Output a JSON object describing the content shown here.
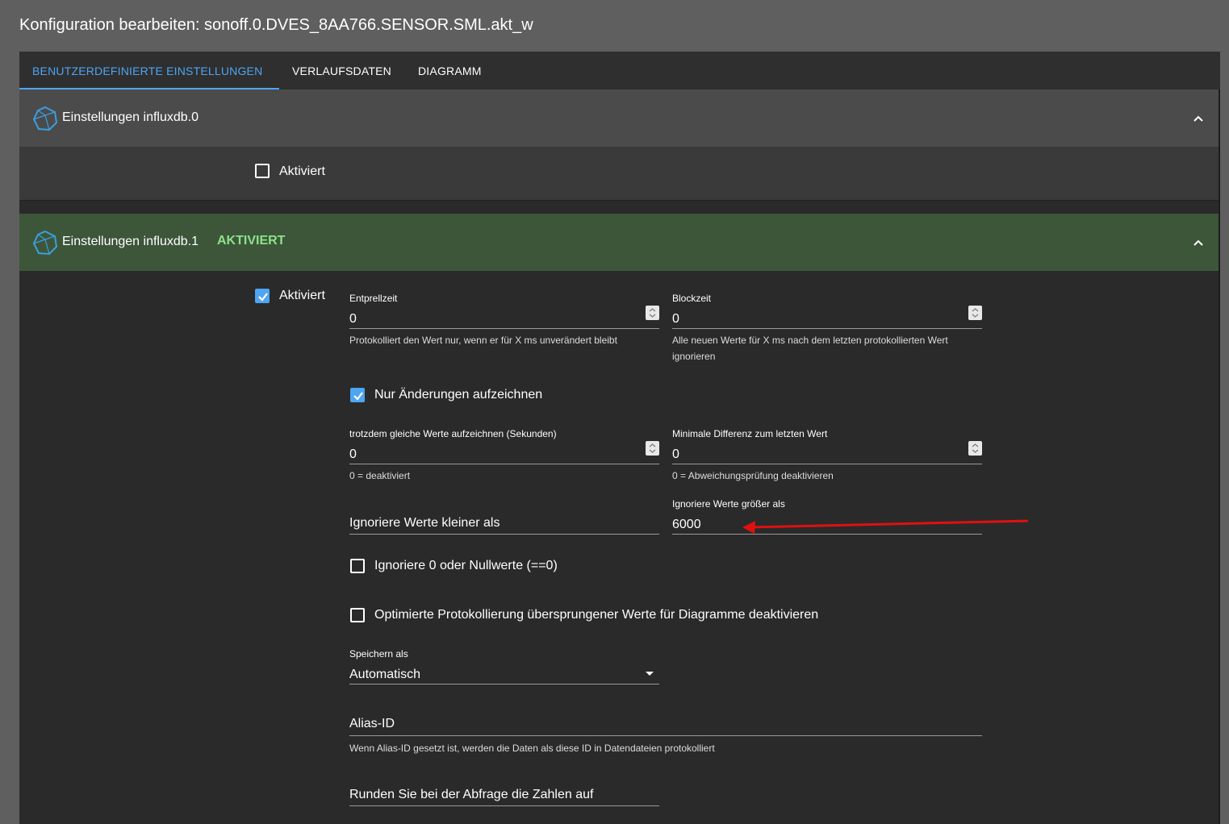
{
  "dialog": {
    "title": "Konfiguration bearbeiten: sonoff.0.DVES_8AA766.SENSOR.SML.akt_w"
  },
  "tabs": [
    {
      "label": "BENUTZERDEFINIERTE EINSTELLUNGEN",
      "active": true
    },
    {
      "label": "VERLAUFSDATEN",
      "active": false
    },
    {
      "label": "DIAGRAMM",
      "active": false
    }
  ],
  "sections": [
    {
      "title": "Einstellungen influxdb.0",
      "badge": "",
      "enabled_label": "Aktiviert",
      "enabled": false
    },
    {
      "title": "Einstellungen influxdb.1",
      "badge": "AKTIVIERT",
      "enabled_label": "Aktiviert",
      "enabled": true,
      "fields": {
        "debounce": {
          "label": "Entprellzeit",
          "value": "0",
          "helper": "Protokolliert den Wert nur, wenn er für X ms unverändert bleibt"
        },
        "blocktime": {
          "label": "Blockzeit",
          "value": "0",
          "helper": "Alle neuen Werte für X ms nach dem letzten protokollierten Wert ignorieren"
        },
        "changes_only": {
          "label": "Nur Änderungen aufzeichnen",
          "checked": true
        },
        "changes_relog": {
          "label": "trotzdem gleiche Werte aufzeichnen (Sekunden)",
          "value": "0",
          "helper": "0 = deaktiviert"
        },
        "changes_min_delta": {
          "label": "Minimale Differenz zum letzten Wert",
          "value": "0",
          "helper": "0 = Abweichungsprüfung deaktivieren"
        },
        "ignore_below": {
          "placeholder": "Ignoriere Werte kleiner als",
          "value": ""
        },
        "ignore_above": {
          "label": "Ignoriere Werte größer als",
          "value": "6000"
        },
        "ignore_zero": {
          "label": "Ignoriere 0 oder Nullwerte (==0)",
          "checked": false
        },
        "disable_skipped": {
          "label": "Optimierte Protokollierung übersprungener Werte für Diagramme deaktivieren",
          "checked": false
        },
        "storage_type": {
          "label": "Speichern als",
          "value": "Automatisch"
        },
        "alias_id": {
          "placeholder": "Alias-ID",
          "helper": "Wenn Alias-ID gesetzt ist, werden die Daten als diese ID in Datendateien protokolliert"
        },
        "round": {
          "placeholder": "Runden Sie bei der Abfrage die Zahlen auf"
        }
      }
    }
  ],
  "colors": {
    "accent": "#4ea5f2",
    "active_badge": "#8be28b",
    "annotation_arrow": "#e01010"
  },
  "icons": {
    "section_icon": "influxdb-icon",
    "collapse_icon": "chevron-up-icon",
    "dropdown_icon": "caret-down-icon"
  }
}
